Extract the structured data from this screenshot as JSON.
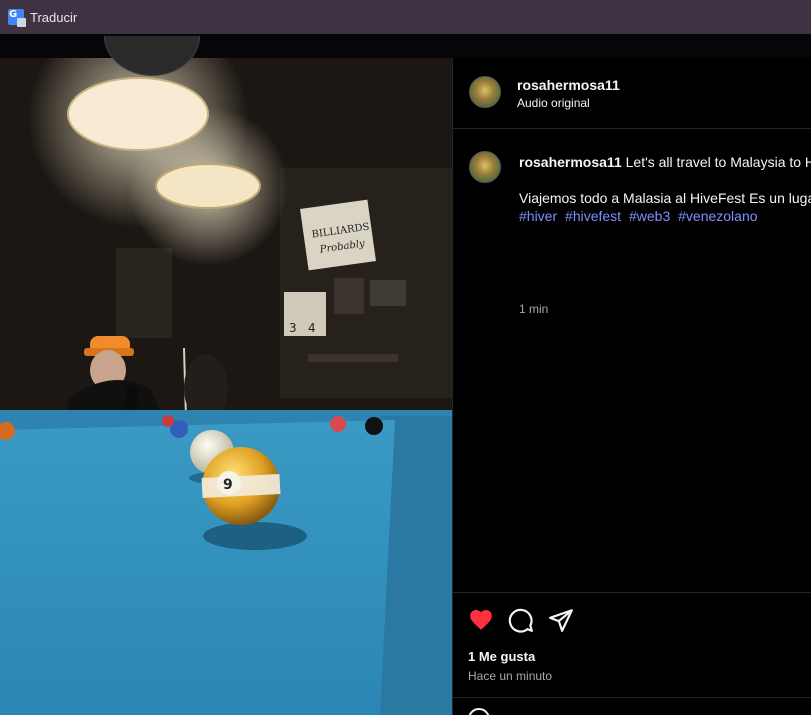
{
  "topbar": {
    "label": "Traducir",
    "icon": "google-translate-icon"
  },
  "post": {
    "username": "rosahermosa11",
    "audio": "Audio original",
    "caption_line1": "Let's all travel to Malaysia to Hive",
    "caption_line2": "Viajemos todo a Malasia al HiveFest Es un lugar",
    "hashtags": [
      "#hiver",
      "#hivefest",
      "#web3",
      "#venezolano"
    ],
    "comment_time": "1 min",
    "likes": "1 Me gusta",
    "posted": "Hace un minuto"
  },
  "colors": {
    "like": "#ff3040",
    "link": "#7e8fff",
    "topbar": "#3f3343"
  },
  "icons": [
    "heart-icon",
    "comment-icon",
    "share-icon"
  ]
}
